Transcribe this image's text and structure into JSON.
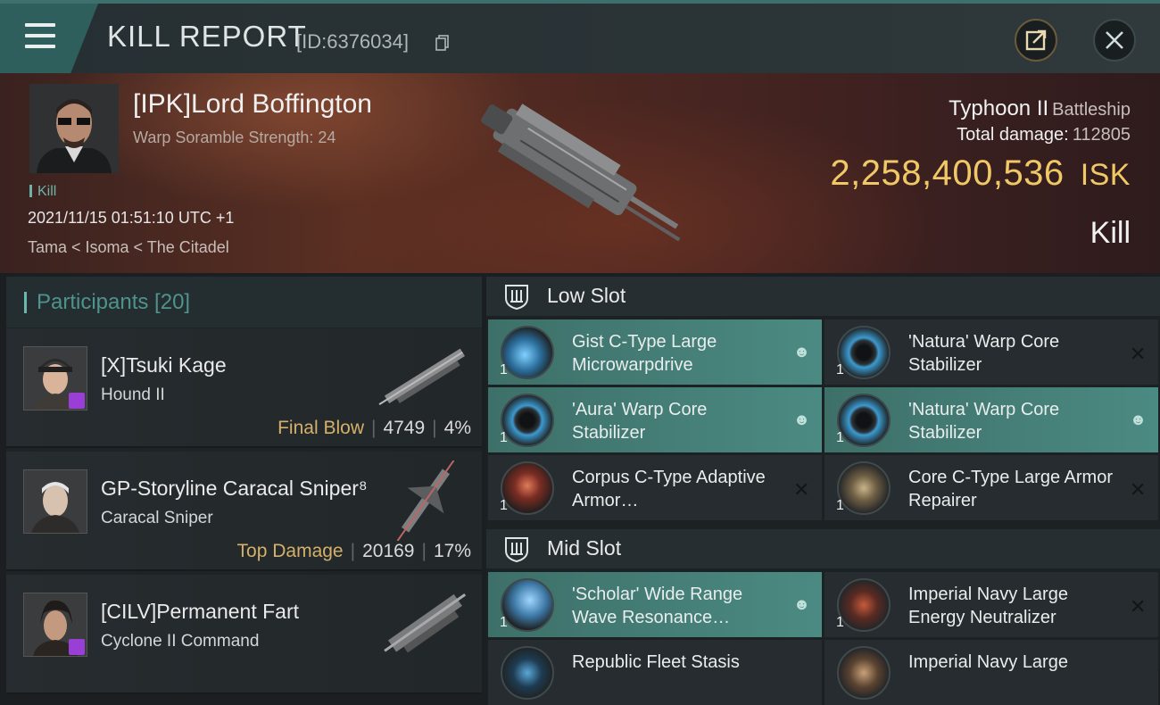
{
  "header": {
    "title": "KILL REPORT",
    "report_id": "[ID:6376034]",
    "menu_icon": "hamburger-icon",
    "export_icon": "export-icon",
    "close_icon": "close-icon"
  },
  "victim": {
    "name": "[IPK]Lord Boffington",
    "scramble": "Warp Soramble Strength: 24",
    "kill_tag": "Kill",
    "time": "2021/11/15 01:51:10 UTC +1",
    "location": "Tama < Isoma < The Citadel",
    "ship": "Typhoon II",
    "ship_class": "Battleship",
    "damage_label": "Total damage:",
    "damage_value": "112805",
    "isk_value": "2,258,400,536",
    "isk_unit": "ISK",
    "result": "Kill"
  },
  "participants": {
    "title": "Participants [20]",
    "items": [
      {
        "name": "[X]Tsuki Kage",
        "ship": "Hound II",
        "tag": "Final Blow",
        "damage": "4749",
        "percent": "4%",
        "badge": true
      },
      {
        "name": "GP-Storyline Caracal Sniper⁸",
        "ship": "Caracal Sniper",
        "tag": "Top Damage",
        "damage": "20169",
        "percent": "17%",
        "badge": false
      },
      {
        "name": "[CILV]Permanent Fart",
        "ship": "Cyclone II Command",
        "tag": "",
        "damage": "",
        "percent": "",
        "badge": true
      }
    ]
  },
  "slots": {
    "low": {
      "title": "Low Slot",
      "modules": [
        {
          "name": "Gist C-Type Large Microwarpdrive",
          "qty": "1",
          "state": "fitted-person",
          "active": true
        },
        {
          "name": "'Natura' Warp Core Stabilizer",
          "qty": "1",
          "state": "destroyed-x",
          "active": false
        },
        {
          "name": "'Aura' Warp Core Stabilizer",
          "qty": "1",
          "state": "fitted-person",
          "active": true
        },
        {
          "name": "'Natura' Warp Core Stabilizer",
          "qty": "1",
          "state": "fitted-person",
          "active": true
        },
        {
          "name": "Corpus C-Type Adaptive Armor…",
          "qty": "1",
          "state": "destroyed-x",
          "active": false
        },
        {
          "name": "Core C-Type Large Armor Repairer",
          "qty": "1",
          "state": "destroyed-x",
          "active": false
        }
      ]
    },
    "mid": {
      "title": "Mid Slot",
      "modules": [
        {
          "name": "'Scholar' Wide Range Wave Resonance…",
          "qty": "1",
          "state": "fitted-person",
          "active": true
        },
        {
          "name": "Imperial Navy Large Energy Neutralizer",
          "qty": "1",
          "state": "destroyed-x",
          "active": false
        },
        {
          "name": "Republic Fleet Stasis",
          "qty": "",
          "state": "",
          "active": false
        },
        {
          "name": "Imperial Navy Large",
          "qty": "",
          "state": "",
          "active": false
        }
      ]
    }
  }
}
